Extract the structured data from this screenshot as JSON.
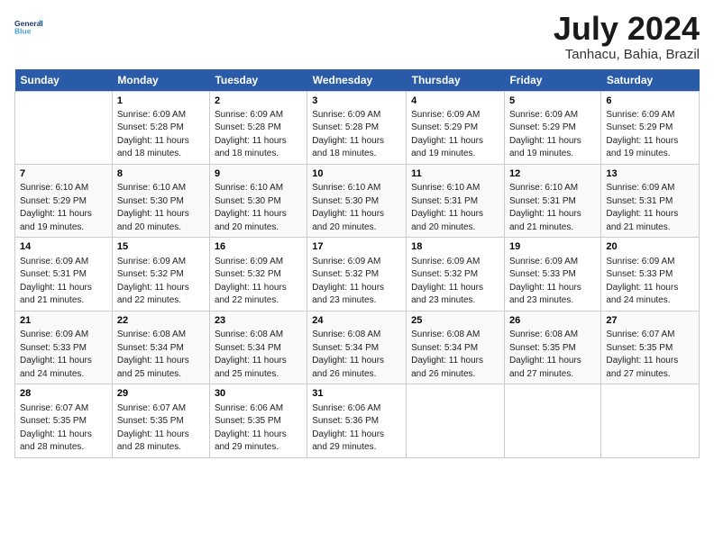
{
  "logo": {
    "line1": "General",
    "line2": "Blue"
  },
  "title": "July 2024",
  "subtitle": "Tanhacu, Bahia, Brazil",
  "header": {
    "days": [
      "Sunday",
      "Monday",
      "Tuesday",
      "Wednesday",
      "Thursday",
      "Friday",
      "Saturday"
    ]
  },
  "weeks": [
    [
      {
        "day": "",
        "info": ""
      },
      {
        "day": "1",
        "info": "Sunrise: 6:09 AM\nSunset: 5:28 PM\nDaylight: 11 hours\nand 18 minutes."
      },
      {
        "day": "2",
        "info": "Sunrise: 6:09 AM\nSunset: 5:28 PM\nDaylight: 11 hours\nand 18 minutes."
      },
      {
        "day": "3",
        "info": "Sunrise: 6:09 AM\nSunset: 5:28 PM\nDaylight: 11 hours\nand 18 minutes."
      },
      {
        "day": "4",
        "info": "Sunrise: 6:09 AM\nSunset: 5:29 PM\nDaylight: 11 hours\nand 19 minutes."
      },
      {
        "day": "5",
        "info": "Sunrise: 6:09 AM\nSunset: 5:29 PM\nDaylight: 11 hours\nand 19 minutes."
      },
      {
        "day": "6",
        "info": "Sunrise: 6:09 AM\nSunset: 5:29 PM\nDaylight: 11 hours\nand 19 minutes."
      }
    ],
    [
      {
        "day": "7",
        "info": "Sunrise: 6:10 AM\nSunset: 5:29 PM\nDaylight: 11 hours\nand 19 minutes."
      },
      {
        "day": "8",
        "info": "Sunrise: 6:10 AM\nSunset: 5:30 PM\nDaylight: 11 hours\nand 20 minutes."
      },
      {
        "day": "9",
        "info": "Sunrise: 6:10 AM\nSunset: 5:30 PM\nDaylight: 11 hours\nand 20 minutes."
      },
      {
        "day": "10",
        "info": "Sunrise: 6:10 AM\nSunset: 5:30 PM\nDaylight: 11 hours\nand 20 minutes."
      },
      {
        "day": "11",
        "info": "Sunrise: 6:10 AM\nSunset: 5:31 PM\nDaylight: 11 hours\nand 20 minutes."
      },
      {
        "day": "12",
        "info": "Sunrise: 6:10 AM\nSunset: 5:31 PM\nDaylight: 11 hours\nand 21 minutes."
      },
      {
        "day": "13",
        "info": "Sunrise: 6:09 AM\nSunset: 5:31 PM\nDaylight: 11 hours\nand 21 minutes."
      }
    ],
    [
      {
        "day": "14",
        "info": "Sunrise: 6:09 AM\nSunset: 5:31 PM\nDaylight: 11 hours\nand 21 minutes."
      },
      {
        "day": "15",
        "info": "Sunrise: 6:09 AM\nSunset: 5:32 PM\nDaylight: 11 hours\nand 22 minutes."
      },
      {
        "day": "16",
        "info": "Sunrise: 6:09 AM\nSunset: 5:32 PM\nDaylight: 11 hours\nand 22 minutes."
      },
      {
        "day": "17",
        "info": "Sunrise: 6:09 AM\nSunset: 5:32 PM\nDaylight: 11 hours\nand 23 minutes."
      },
      {
        "day": "18",
        "info": "Sunrise: 6:09 AM\nSunset: 5:32 PM\nDaylight: 11 hours\nand 23 minutes."
      },
      {
        "day": "19",
        "info": "Sunrise: 6:09 AM\nSunset: 5:33 PM\nDaylight: 11 hours\nand 23 minutes."
      },
      {
        "day": "20",
        "info": "Sunrise: 6:09 AM\nSunset: 5:33 PM\nDaylight: 11 hours\nand 24 minutes."
      }
    ],
    [
      {
        "day": "21",
        "info": "Sunrise: 6:09 AM\nSunset: 5:33 PM\nDaylight: 11 hours\nand 24 minutes."
      },
      {
        "day": "22",
        "info": "Sunrise: 6:08 AM\nSunset: 5:34 PM\nDaylight: 11 hours\nand 25 minutes."
      },
      {
        "day": "23",
        "info": "Sunrise: 6:08 AM\nSunset: 5:34 PM\nDaylight: 11 hours\nand 25 minutes."
      },
      {
        "day": "24",
        "info": "Sunrise: 6:08 AM\nSunset: 5:34 PM\nDaylight: 11 hours\nand 26 minutes."
      },
      {
        "day": "25",
        "info": "Sunrise: 6:08 AM\nSunset: 5:34 PM\nDaylight: 11 hours\nand 26 minutes."
      },
      {
        "day": "26",
        "info": "Sunrise: 6:08 AM\nSunset: 5:35 PM\nDaylight: 11 hours\nand 27 minutes."
      },
      {
        "day": "27",
        "info": "Sunrise: 6:07 AM\nSunset: 5:35 PM\nDaylight: 11 hours\nand 27 minutes."
      }
    ],
    [
      {
        "day": "28",
        "info": "Sunrise: 6:07 AM\nSunset: 5:35 PM\nDaylight: 11 hours\nand 28 minutes."
      },
      {
        "day": "29",
        "info": "Sunrise: 6:07 AM\nSunset: 5:35 PM\nDaylight: 11 hours\nand 28 minutes."
      },
      {
        "day": "30",
        "info": "Sunrise: 6:06 AM\nSunset: 5:35 PM\nDaylight: 11 hours\nand 29 minutes."
      },
      {
        "day": "31",
        "info": "Sunrise: 6:06 AM\nSunset: 5:36 PM\nDaylight: 11 hours\nand 29 minutes."
      },
      {
        "day": "",
        "info": ""
      },
      {
        "day": "",
        "info": ""
      },
      {
        "day": "",
        "info": ""
      }
    ]
  ]
}
